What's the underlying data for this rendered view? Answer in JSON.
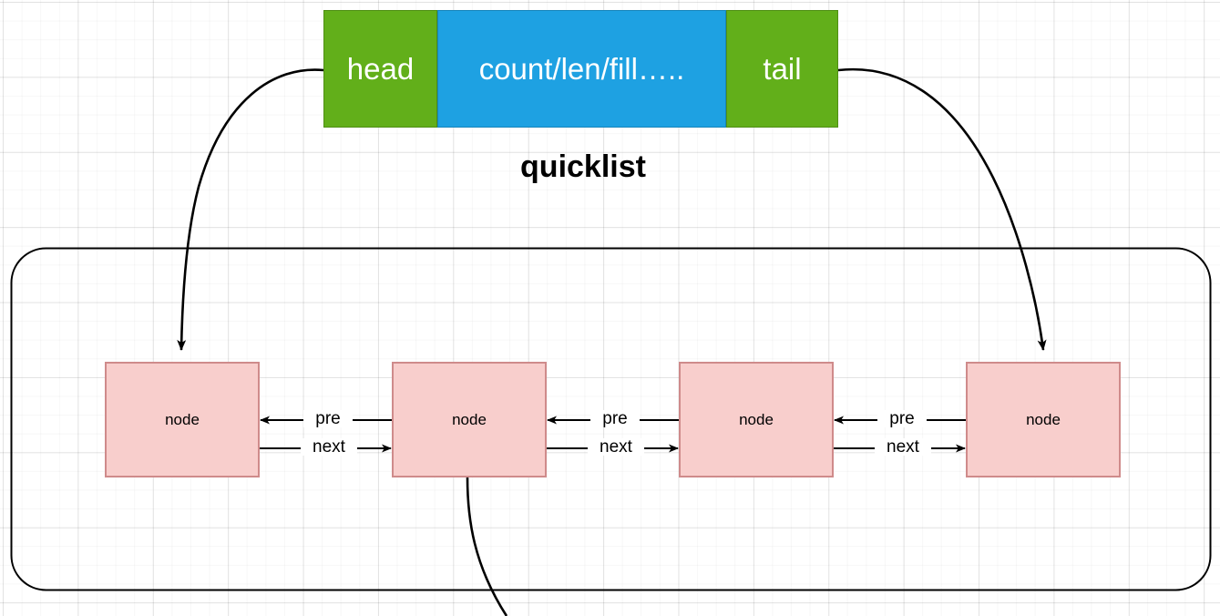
{
  "diagram": {
    "title": "quicklist",
    "header": {
      "head_label": "head",
      "meta_label": "count/len/fill…..",
      "tail_label": "tail",
      "head_color": "#62af1a",
      "meta_color": "#1ea1e2",
      "tail_color": "#62af1a",
      "text_color": "#ffffff"
    },
    "container": {
      "name": "node-list-container",
      "stroke_color": "#000000"
    },
    "node_color": "#f8cecc",
    "node_border_color": "#cf8b8b",
    "nodes": [
      {
        "label": "node"
      },
      {
        "label": "node"
      },
      {
        "label": "node"
      },
      {
        "label": "node"
      }
    ],
    "links": [
      {
        "prev_label": "pre",
        "next_label": "next"
      },
      {
        "prev_label": "pre",
        "next_label": "next"
      },
      {
        "prev_label": "pre",
        "next_label": "next"
      }
    ],
    "pointers": [
      {
        "from": "head",
        "to": "node-1"
      },
      {
        "from": "tail",
        "to": "node-4"
      }
    ]
  }
}
